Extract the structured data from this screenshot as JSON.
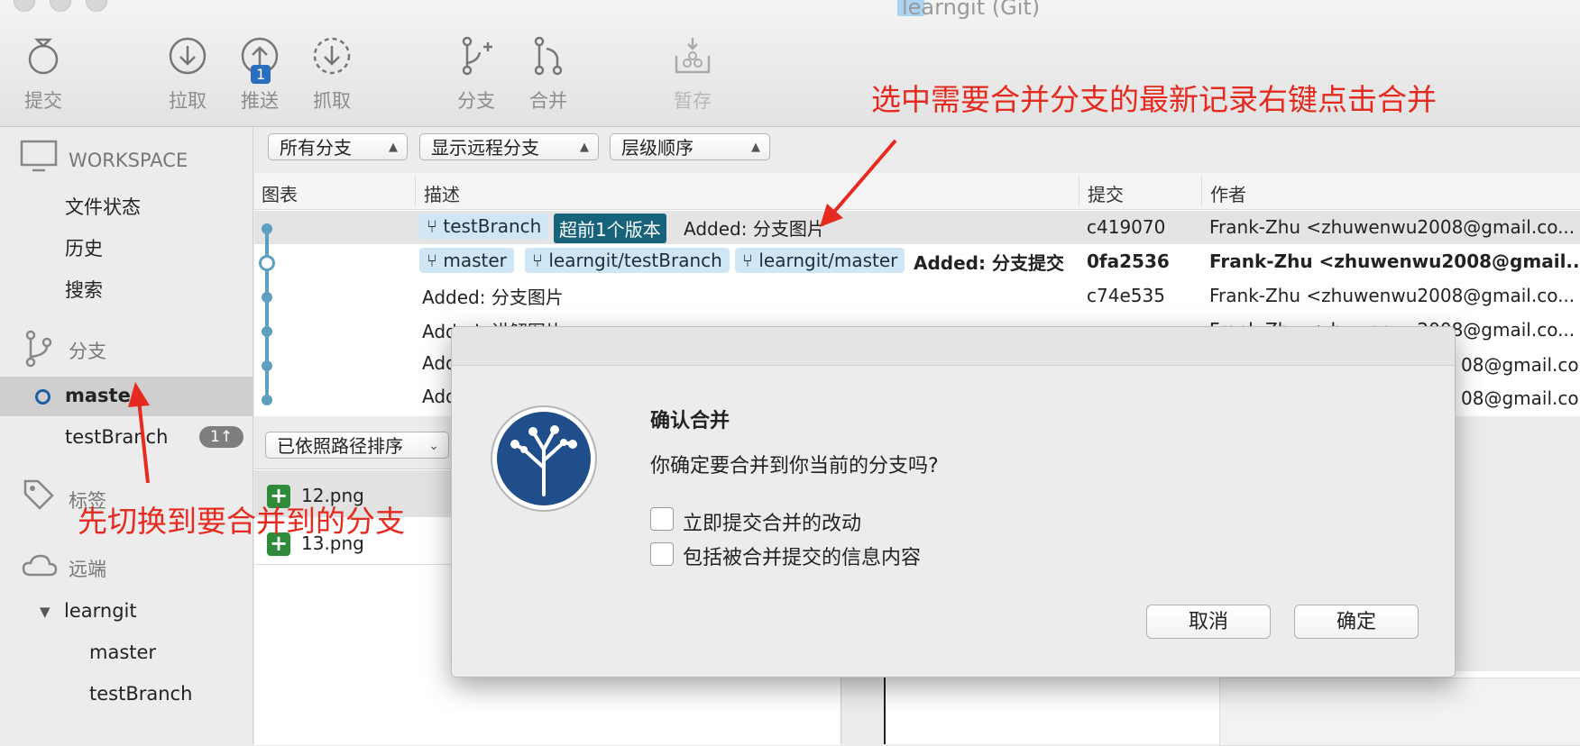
{
  "window": {
    "title": "learngit (Git)"
  },
  "toolbar": {
    "commit": "提交",
    "pull": "拉取",
    "push": "推送",
    "push_badge": "1",
    "fetch": "抓取",
    "branch": "分支",
    "merge": "合并",
    "stash": "暂存"
  },
  "sidebar": {
    "workspace": "WORKSPACE",
    "workspace_items": [
      "文件状态",
      "历史",
      "搜索"
    ],
    "branches_header": "分支",
    "branches": [
      {
        "name": "master",
        "current": true
      },
      {
        "name": "testBranch",
        "count": "1↑"
      }
    ],
    "tags_header": "标签",
    "remotes_header": "远端",
    "remote_name": "learngit",
    "remote_branches": [
      "master",
      "testBranch"
    ]
  },
  "filters": {
    "branches": "所有分支",
    "remote": "显示远程分支",
    "order": "层级顺序"
  },
  "table": {
    "headers": {
      "graph": "图表",
      "desc": "描述",
      "commit": "提交",
      "author": "作者"
    },
    "rows": [
      {
        "tags": [
          "testBranch"
        ],
        "ahead": "超前1个版本",
        "desc": "Added: 分支图片",
        "commit": "c419070",
        "author": "Frank-Zhu <zhuwenwu2008@gmail.co..."
      },
      {
        "tags": [
          "master",
          "learngit/testBranch",
          "learngit/master"
        ],
        "desc": "Added: 分支提交",
        "commit": "0fa2536",
        "author": "Frank-Zhu <zhuwenwu2008@gmail..."
      },
      {
        "desc": "Added: 分支图片",
        "commit": "c74e535",
        "author": "Frank-Zhu <zhuwenwu2008@gmail.co..."
      },
      {
        "desc": "Added: 讲解图片",
        "commit": "",
        "author": "Frank-Zhu <zhuwenwu2008@gmail.co..."
      },
      {
        "desc": "Add",
        "commit": "",
        "author": "08@gmail.co..."
      },
      {
        "desc": "Add",
        "commit": "",
        "author": "08@gmail.co..."
      }
    ]
  },
  "lower": {
    "sort": "已依照路径排序",
    "files": [
      "12.png",
      "13.png"
    ]
  },
  "dialog": {
    "title": "确认合并",
    "message": "你确定要合并到你当前的分支吗?",
    "option1": "立即提交合并的改动",
    "option2": "包括被合并提交的信息内容",
    "cancel": "取消",
    "ok": "确定"
  },
  "annotations": {
    "top": "选中需要合并分支的最新记录右键点击合并",
    "left": "先切换到要合并到的分支"
  },
  "colors": {
    "accent": "#2a6ebd",
    "annotation": "#e62a1f",
    "tag": "#cfe6f4",
    "graph": "#5e9fbf"
  }
}
